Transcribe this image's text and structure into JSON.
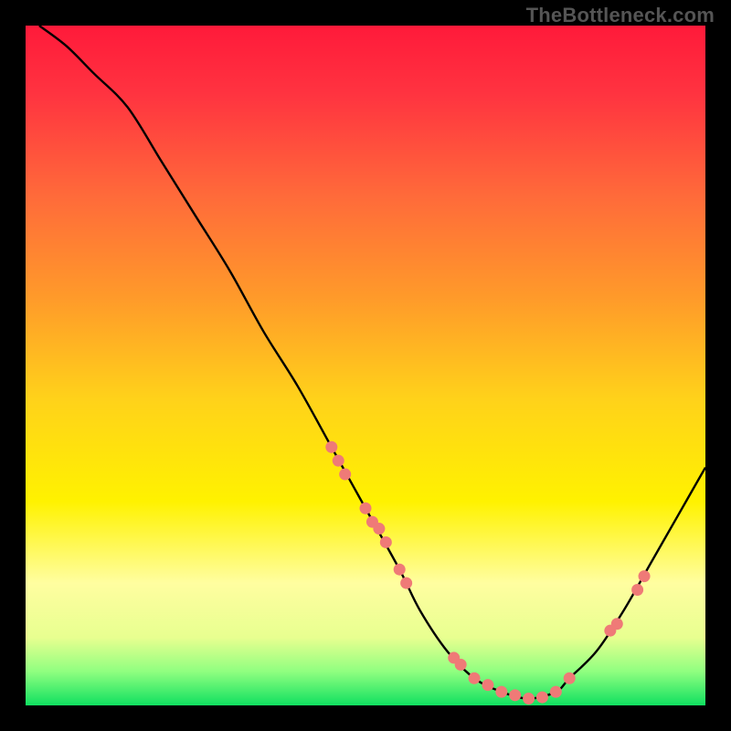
{
  "watermark": "TheBottleneck.com",
  "chart_data": {
    "type": "line",
    "title": "",
    "xlabel": "",
    "ylabel": "",
    "xlim": [
      0,
      100
    ],
    "ylim": [
      0,
      100
    ],
    "grid": false,
    "legend": false,
    "series": [
      {
        "name": "curve",
        "x": [
          2,
          6,
          10,
          15,
          20,
          25,
          30,
          35,
          40,
          45,
          50,
          55,
          58,
          62,
          66,
          70,
          74,
          78,
          80,
          84,
          88,
          92,
          96,
          100
        ],
        "y": [
          100,
          97,
          93,
          88,
          80,
          72,
          64,
          55,
          47,
          38,
          29,
          20,
          14,
          8,
          4,
          2,
          1,
          2,
          4,
          8,
          14,
          21,
          28,
          35
        ]
      }
    ],
    "points": {
      "name": "markers",
      "color": "#ef7a77",
      "x": [
        45,
        46,
        47,
        50,
        51,
        52,
        53,
        55,
        56,
        63,
        64,
        66,
        68,
        70,
        72,
        74,
        76,
        78,
        80,
        86,
        87,
        90,
        91
      ],
      "y": [
        38,
        36,
        34,
        29,
        27,
        26,
        24,
        20,
        18,
        7,
        6,
        4,
        3,
        2,
        1.5,
        1,
        1.2,
        2,
        4,
        11,
        12,
        17,
        19
      ]
    },
    "background": {
      "type": "vertical-gradient",
      "stops": [
        {
          "pos": 0.0,
          "color": "#ff1a3a"
        },
        {
          "pos": 0.1,
          "color": "#ff3340"
        },
        {
          "pos": 0.25,
          "color": "#ff6a3a"
        },
        {
          "pos": 0.4,
          "color": "#ff9a2a"
        },
        {
          "pos": 0.55,
          "color": "#ffd21a"
        },
        {
          "pos": 0.7,
          "color": "#fff200"
        },
        {
          "pos": 0.82,
          "color": "#fffea0"
        },
        {
          "pos": 0.9,
          "color": "#e8ff90"
        },
        {
          "pos": 0.95,
          "color": "#90ff80"
        },
        {
          "pos": 1.0,
          "color": "#10e060"
        }
      ]
    }
  }
}
